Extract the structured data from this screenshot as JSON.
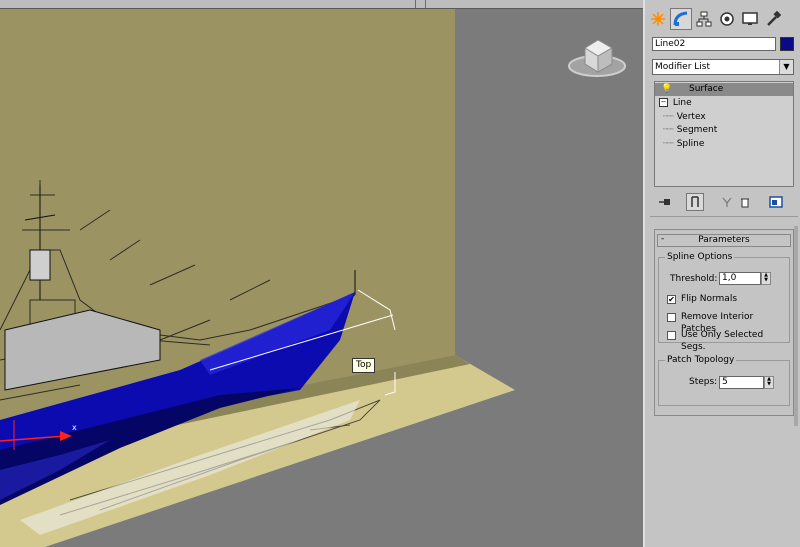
{
  "viewport": {
    "label": "Top",
    "axis_x": "x"
  },
  "panel": {
    "tabs": [
      {
        "icon": "create-icon"
      },
      {
        "icon": "modify-icon",
        "active": true
      },
      {
        "icon": "hierarchy-icon"
      },
      {
        "icon": "motion-icon"
      },
      {
        "icon": "display-icon"
      },
      {
        "icon": "utilities-icon"
      }
    ],
    "object_name": "Line02",
    "object_color": "#0a0a86",
    "modifier_list": "Modifier List",
    "stack": {
      "items": [
        {
          "label": "Surface",
          "selected": true
        },
        {
          "label": "Line"
        },
        {
          "label": "Vertex"
        },
        {
          "label": "Segment"
        },
        {
          "label": "Spline"
        }
      ]
    },
    "parameters": {
      "title": "Parameters",
      "collapse": "-",
      "spline_options": {
        "legend": "Spline Options",
        "threshold_label": "Threshold:",
        "threshold_value": "1,0",
        "flip_normals": "Flip Normals",
        "flip_normals_checked": "✔",
        "remove_interior": "Remove Interior Patches",
        "use_selected": "Use Only Selected Segs."
      },
      "patch_topology": {
        "legend": "Patch Topology",
        "steps_label": "Steps:",
        "steps_value": "5"
      }
    }
  }
}
